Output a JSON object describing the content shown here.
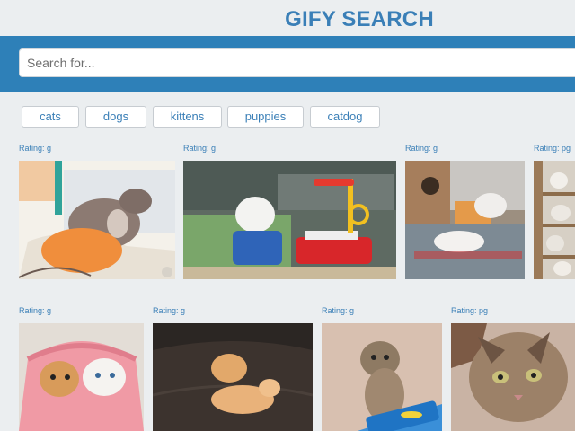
{
  "header": {
    "title": "GIFY SEARCH"
  },
  "search": {
    "placeholder": "Search for...",
    "value": ""
  },
  "tags": [
    "cats",
    "dogs",
    "kittens",
    "puppies",
    "catdog"
  ],
  "results_row1": [
    {
      "rating": "Rating: g"
    },
    {
      "rating": "Rating: g"
    },
    {
      "rating": "Rating: g"
    },
    {
      "rating": "Rating: pg"
    }
  ],
  "results_row2": [
    {
      "rating": "Rating: g"
    },
    {
      "rating": "Rating: g"
    },
    {
      "rating": "Rating: g"
    },
    {
      "rating": "Rating: pg"
    }
  ],
  "colors": {
    "accent": "#3a7fb7",
    "band": "#2e80b8",
    "background": "#ebeef0"
  }
}
